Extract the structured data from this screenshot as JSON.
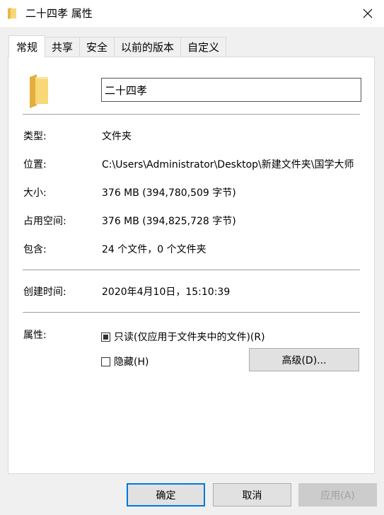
{
  "window": {
    "title": "二十四孝 属性",
    "accent_color": "#0078d7",
    "folder_color": "#f8d775"
  },
  "tabs": [
    {
      "label": "常规",
      "active": true
    },
    {
      "label": "共享",
      "active": false
    },
    {
      "label": "安全",
      "active": false
    },
    {
      "label": "以前的版本",
      "active": false
    },
    {
      "label": "自定义",
      "active": false
    }
  ],
  "general": {
    "name_value": "二十四孝",
    "type_label": "类型:",
    "type_value": "文件夹",
    "location_label": "位置:",
    "location_value": "C:\\Users\\Administrator\\Desktop\\新建文件夹\\国学大师",
    "size_label": "大小:",
    "size_value": "376 MB (394,780,509 字节)",
    "size_on_disk_label": "占用空间:",
    "size_on_disk_value": "376 MB (394,825,728 字节)",
    "contains_label": "包含:",
    "contains_value": "24 个文件，0 个文件夹",
    "created_label": "创建时间:",
    "created_value": "2020年4月10日，15:10:39",
    "attributes_label": "属性:",
    "readonly_label": "只读(仅应用于文件夹中的文件)(R)",
    "readonly_state": "indeterminate",
    "hidden_label": "隐藏(H)",
    "hidden_state": "unchecked",
    "advanced_label": "高级(D)..."
  },
  "footer": {
    "ok_label": "确定",
    "cancel_label": "取消",
    "apply_label": "应用(A)"
  }
}
